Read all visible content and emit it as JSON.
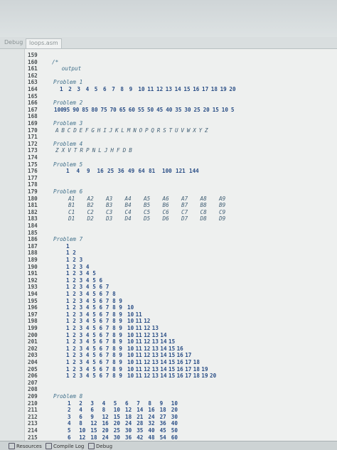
{
  "tabs": {
    "left_label": "Debug",
    "file_label": "loops.asm"
  },
  "bottom": {
    "items": [
      "Resources",
      "Compile Log",
      "Debug"
    ]
  },
  "lines": [
    {
      "n": "159",
      "text": ""
    },
    {
      "n": "160",
      "text": "/*"
    },
    {
      "n": "161",
      "text": "   output"
    },
    {
      "n": "162",
      "text": ""
    },
    {
      "n": "163",
      "text": "Problem 1"
    },
    {
      "n": "164",
      "tokens": [
        "1",
        "2",
        "3",
        "4",
        "5",
        "6",
        "7",
        "8",
        "9",
        "10",
        "11",
        "12",
        "13",
        "14",
        "15",
        "16",
        "17",
        "18",
        "19",
        "20"
      ]
    },
    {
      "n": "165",
      "text": ""
    },
    {
      "n": "166",
      "text": "Problem 2"
    },
    {
      "n": "167",
      "tokens": [
        "100",
        "95",
        "90",
        "85",
        "80",
        "75",
        "70",
        "65",
        "60",
        "55",
        "50",
        "45",
        "40",
        "35",
        "30",
        "25",
        "20",
        "15",
        "10",
        "5"
      ]
    },
    {
      "n": "168",
      "text": ""
    },
    {
      "n": "169",
      "text": "Problem 3"
    },
    {
      "n": "170",
      "tokens": [
        "A",
        "B",
        "C",
        "D",
        "E",
        "F",
        "G",
        "H",
        "I",
        "J",
        "K",
        "L",
        "M",
        "N",
        "O",
        "P",
        "Q",
        "R",
        "S",
        "T",
        "U",
        "V",
        "W",
        "X",
        "Y",
        "Z"
      ]
    },
    {
      "n": "171",
      "text": ""
    },
    {
      "n": "172",
      "text": "Problem 4"
    },
    {
      "n": "173",
      "tokens": [
        "Z",
        "X",
        "V",
        "T",
        "R",
        "P",
        "N",
        "L",
        "J",
        "H",
        "F",
        "D",
        "B"
      ]
    },
    {
      "n": "174",
      "text": ""
    },
    {
      "n": "175",
      "text": "Problem 5"
    },
    {
      "n": "176",
      "tokens": [
        "1",
        "4",
        "9",
        "16",
        "25",
        "36",
        "49",
        "64",
        "81",
        "100",
        "121",
        "144"
      ]
    },
    {
      "n": "177",
      "text": ""
    },
    {
      "n": "178",
      "text": ""
    },
    {
      "n": "179",
      "text": "Problem 6"
    },
    {
      "n": "180",
      "tokens": [
        "A1",
        "A2",
        "A3",
        "A4",
        "A5",
        "A6",
        "A7",
        "A8",
        "A9"
      ]
    },
    {
      "n": "181",
      "tokens": [
        "B1",
        "B2",
        "B3",
        "B4",
        "B5",
        "B6",
        "B7",
        "B8",
        "B9"
      ]
    },
    {
      "n": "182",
      "tokens": [
        "C1",
        "C2",
        "C3",
        "C4",
        "C5",
        "C6",
        "C7",
        "C8",
        "C9"
      ]
    },
    {
      "n": "183",
      "tokens": [
        "D1",
        "D2",
        "D3",
        "D4",
        "D5",
        "D6",
        "D7",
        "D8",
        "D9"
      ]
    },
    {
      "n": "184",
      "text": ""
    },
    {
      "n": "185",
      "text": ""
    },
    {
      "n": "186",
      "text": "Problem 7"
    },
    {
      "n": "187",
      "tokens": [
        "1"
      ]
    },
    {
      "n": "188",
      "tokens": [
        "1",
        "2"
      ]
    },
    {
      "n": "189",
      "tokens": [
        "1",
        "2",
        "3"
      ]
    },
    {
      "n": "190",
      "tokens": [
        "1",
        "2",
        "3",
        "4"
      ]
    },
    {
      "n": "191",
      "tokens": [
        "1",
        "2",
        "3",
        "4",
        "5"
      ]
    },
    {
      "n": "192",
      "tokens": [
        "1",
        "2",
        "3",
        "4",
        "5",
        "6"
      ]
    },
    {
      "n": "193",
      "tokens": [
        "1",
        "2",
        "3",
        "4",
        "5",
        "6",
        "7"
      ]
    },
    {
      "n": "194",
      "tokens": [
        "1",
        "2",
        "3",
        "4",
        "5",
        "6",
        "7",
        "8"
      ]
    },
    {
      "n": "195",
      "tokens": [
        "1",
        "2",
        "3",
        "4",
        "5",
        "6",
        "7",
        "8",
        "9"
      ]
    },
    {
      "n": "196",
      "tokens": [
        "1",
        "2",
        "3",
        "4",
        "5",
        "6",
        "7",
        "8",
        "9",
        "10"
      ]
    },
    {
      "n": "197",
      "tokens": [
        "1",
        "2",
        "3",
        "4",
        "5",
        "6",
        "7",
        "8",
        "9",
        "10",
        "11"
      ]
    },
    {
      "n": "198",
      "tokens": [
        "1",
        "2",
        "3",
        "4",
        "5",
        "6",
        "7",
        "8",
        "9",
        "10",
        "11",
        "12"
      ]
    },
    {
      "n": "199",
      "tokens": [
        "1",
        "2",
        "3",
        "4",
        "5",
        "6",
        "7",
        "8",
        "9",
        "10",
        "11",
        "12",
        "13"
      ]
    },
    {
      "n": "200",
      "tokens": [
        "1",
        "2",
        "3",
        "4",
        "5",
        "6",
        "7",
        "8",
        "9",
        "10",
        "11",
        "12",
        "13",
        "14"
      ]
    },
    {
      "n": "201",
      "tokens": [
        "1",
        "2",
        "3",
        "4",
        "5",
        "6",
        "7",
        "8",
        "9",
        "10",
        "11",
        "12",
        "13",
        "14",
        "15"
      ]
    },
    {
      "n": "202",
      "tokens": [
        "1",
        "2",
        "3",
        "4",
        "5",
        "6",
        "7",
        "8",
        "9",
        "10",
        "11",
        "12",
        "13",
        "14",
        "15",
        "16"
      ]
    },
    {
      "n": "203",
      "tokens": [
        "1",
        "2",
        "3",
        "4",
        "5",
        "6",
        "7",
        "8",
        "9",
        "10",
        "11",
        "12",
        "13",
        "14",
        "15",
        "16",
        "17"
      ]
    },
    {
      "n": "204",
      "tokens": [
        "1",
        "2",
        "3",
        "4",
        "5",
        "6",
        "7",
        "8",
        "9",
        "10",
        "11",
        "12",
        "13",
        "14",
        "15",
        "16",
        "17",
        "18"
      ]
    },
    {
      "n": "205",
      "tokens": [
        "1",
        "2",
        "3",
        "4",
        "5",
        "6",
        "7",
        "8",
        "9",
        "10",
        "11",
        "12",
        "13",
        "14",
        "15",
        "16",
        "17",
        "18",
        "19"
      ]
    },
    {
      "n": "206",
      "tokens": [
        "1",
        "2",
        "3",
        "4",
        "5",
        "6",
        "7",
        "8",
        "9",
        "10",
        "11",
        "12",
        "13",
        "14",
        "15",
        "16",
        "17",
        "18",
        "19",
        "20"
      ]
    },
    {
      "n": "207",
      "text": ""
    },
    {
      "n": "208",
      "text": ""
    },
    {
      "n": "209",
      "text": "Problem 8"
    },
    {
      "n": "210",
      "tokens": [
        "1",
        "2",
        "3",
        "4",
        "5",
        "6",
        "7",
        "8",
        "9",
        "10"
      ]
    },
    {
      "n": "211",
      "tokens": [
        "2",
        "4",
        "6",
        "8",
        "10",
        "12",
        "14",
        "16",
        "18",
        "20"
      ]
    },
    {
      "n": "212",
      "tokens": [
        "3",
        "6",
        "9",
        "12",
        "15",
        "18",
        "21",
        "24",
        "27",
        "30"
      ]
    },
    {
      "n": "213",
      "tokens": [
        "4",
        "8",
        "12",
        "16",
        "20",
        "24",
        "28",
        "32",
        "36",
        "40"
      ]
    },
    {
      "n": "214",
      "tokens": [
        "5",
        "10",
        "15",
        "20",
        "25",
        "30",
        "35",
        "40",
        "45",
        "50"
      ]
    },
    {
      "n": "215",
      "tokens": [
        "6",
        "12",
        "18",
        "24",
        "30",
        "36",
        "42",
        "48",
        "54",
        "60"
      ]
    }
  ]
}
